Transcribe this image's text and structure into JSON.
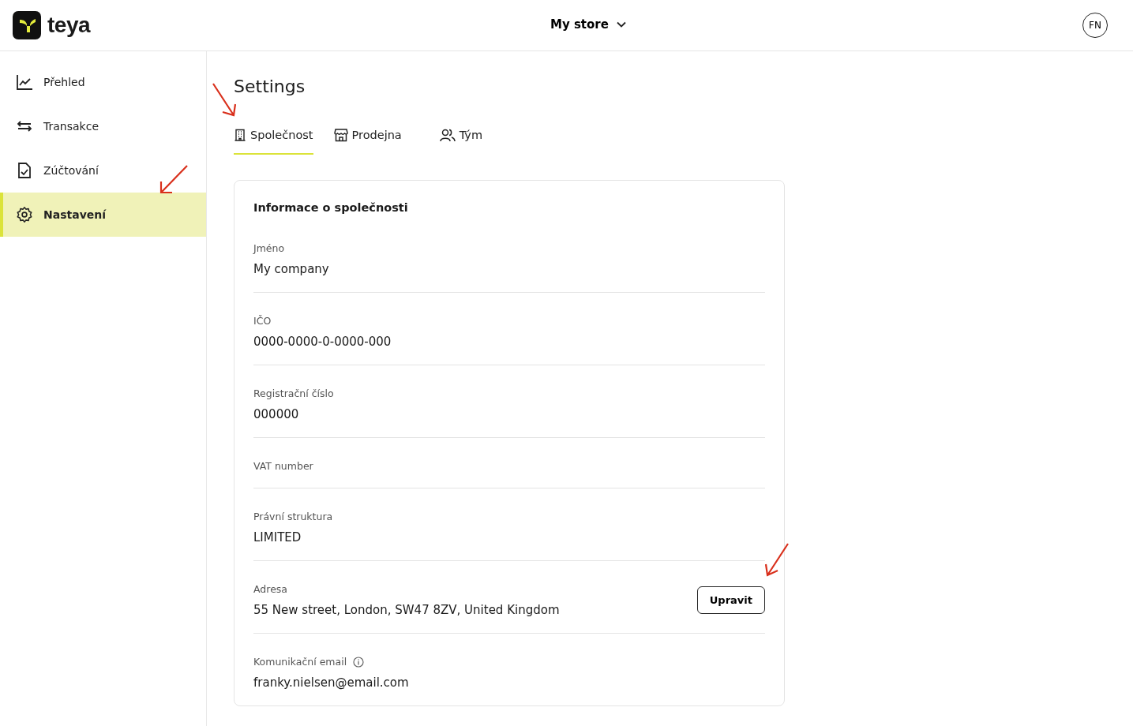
{
  "header": {
    "brand": "teya",
    "store": "My store",
    "avatar": "FN"
  },
  "sidebar": {
    "items": [
      {
        "label": "Přehled",
        "selected": false
      },
      {
        "label": "Transakce",
        "selected": false
      },
      {
        "label": "Zúčtování",
        "selected": false
      },
      {
        "label": "Nastavení",
        "selected": true
      }
    ]
  },
  "page": {
    "title": "Settings"
  },
  "tabs": [
    {
      "label": "Společnost",
      "selected": true
    },
    {
      "label": "Prodejna",
      "selected": false
    },
    {
      "label": "Tým",
      "selected": false
    }
  ],
  "card": {
    "title": "Informace o společnosti",
    "fields": [
      {
        "label": "Jméno",
        "value": "My company",
        "info": false
      },
      {
        "label": "IČO",
        "value": "0000-0000-0-0000-000",
        "info": false
      },
      {
        "label": "Registrační číslo",
        "value": "000000",
        "info": false
      },
      {
        "label": "VAT number",
        "info": false
      },
      {
        "label": "Právní struktura",
        "value": "LIMITED",
        "info": false
      },
      {
        "label": "Adresa",
        "value": "55 New street, London, SW47 8ZV, United Kingdom",
        "action": "Upravit",
        "info": false
      },
      {
        "label": "Komunikační email",
        "value": "franky.nielsen@email.com",
        "info": true
      }
    ]
  }
}
